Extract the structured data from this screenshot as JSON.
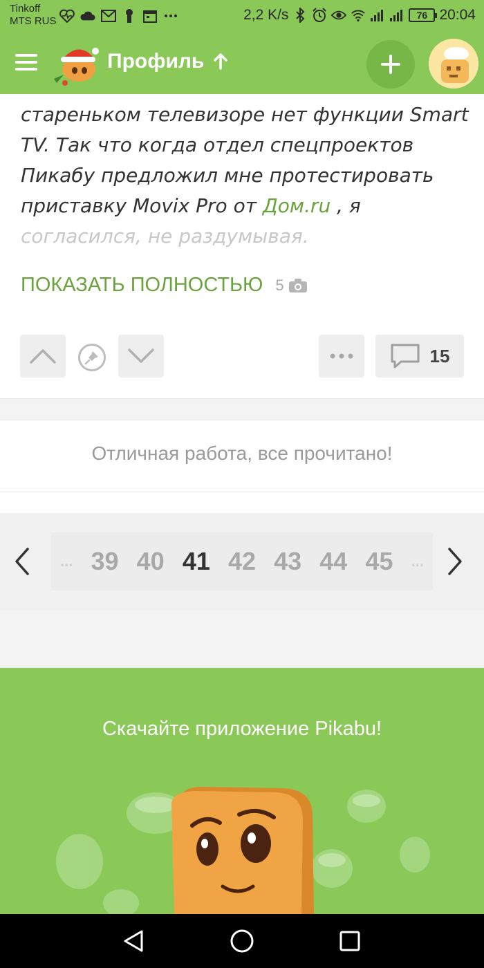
{
  "status_bar": {
    "carrier_1": "Tinkoff",
    "carrier_2": "MTS RUS",
    "speed": "2,2 K/s",
    "battery": "76",
    "time": "20:04",
    "left_icons": [
      "heart-pulse-icon",
      "cloud-icon",
      "gmail-icon",
      "keyhole-icon",
      "calendar-icon",
      "more-dots-icon"
    ],
    "right_icons": [
      "bluetooth-icon",
      "alarm-icon",
      "eye-icon",
      "wifi-icon",
      "signal-icon",
      "signal-icon"
    ]
  },
  "header": {
    "title": "Профиль",
    "title_icon": "arrow-up-icon",
    "menu_icon": "hamburger-icon",
    "add_icon": "plus-icon",
    "accent": "#8ac858"
  },
  "post": {
    "text_lines": [
      "стареньком телевизоре нет функции Smart",
      "TV. Так что когда отдел спецпроектов",
      "Пикабу предложил мне протестировать"
    ],
    "line4_before": "приставку Movix Pro от ",
    "line4_link": "Дом.ru",
    "line4_after": " , я",
    "faded_line": "согласился, не раздумывая.",
    "show_more": "ПОКАЗАТЬ ПОЛНОСТЬЮ",
    "image_count": "5",
    "comments_count": "15",
    "link_color": "#6aa33d"
  },
  "feed": {
    "done_message": "Отличная работа, все прочитано!"
  },
  "pagination": {
    "ellipsis": "...",
    "pages": [
      "39",
      "40",
      "41",
      "42",
      "43",
      "44",
      "45"
    ],
    "current": "41"
  },
  "promo": {
    "text": "Скачайте приложение Pikabu!"
  }
}
